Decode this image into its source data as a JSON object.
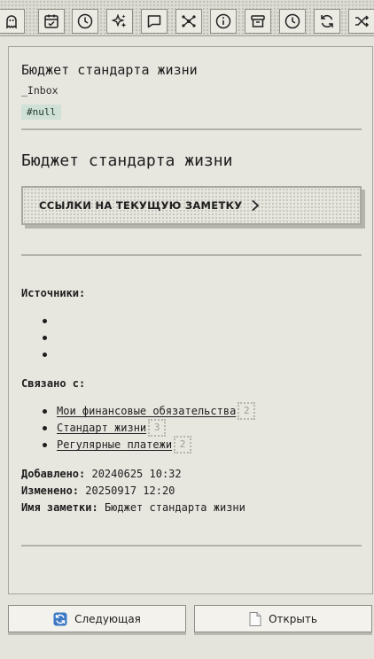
{
  "toolbar": {
    "icons": [
      "ghost-icon",
      "calendar-check-icon",
      "clock-icon",
      "sparkles-icon",
      "message-icon",
      "graph-icon",
      "info-icon",
      "archive-icon",
      "history-icon",
      "refresh-icon",
      "shuffle-icon"
    ]
  },
  "note": {
    "header_title": "Бюджет стандарта жизни",
    "folder": "_Inbox",
    "tag": "#null",
    "heading": "Бюджет стандарта жизни",
    "refs_button": "ССЫЛКИ НА ТЕКУЩУЮ ЗАМЕТКУ",
    "sources_label": "Источники:",
    "sources_count_bullets": 3,
    "related_label": "Связано с:",
    "related": [
      {
        "label": "Мои финансовые обязательства",
        "count": "2"
      },
      {
        "label": "Стандарт жизни",
        "count": "3"
      },
      {
        "label": "Регулярные платежи",
        "count": "2"
      }
    ],
    "added_label": "Добавлено:",
    "added_value": "20240625 10:32",
    "modified_label": "Изменено:",
    "modified_value": "20250917 12:20",
    "name_label": "Имя заметки:",
    "name_value": "Бюджет стандарта жизни"
  },
  "footer": {
    "next_label": "Следующая",
    "open_label": "Открыть"
  }
}
